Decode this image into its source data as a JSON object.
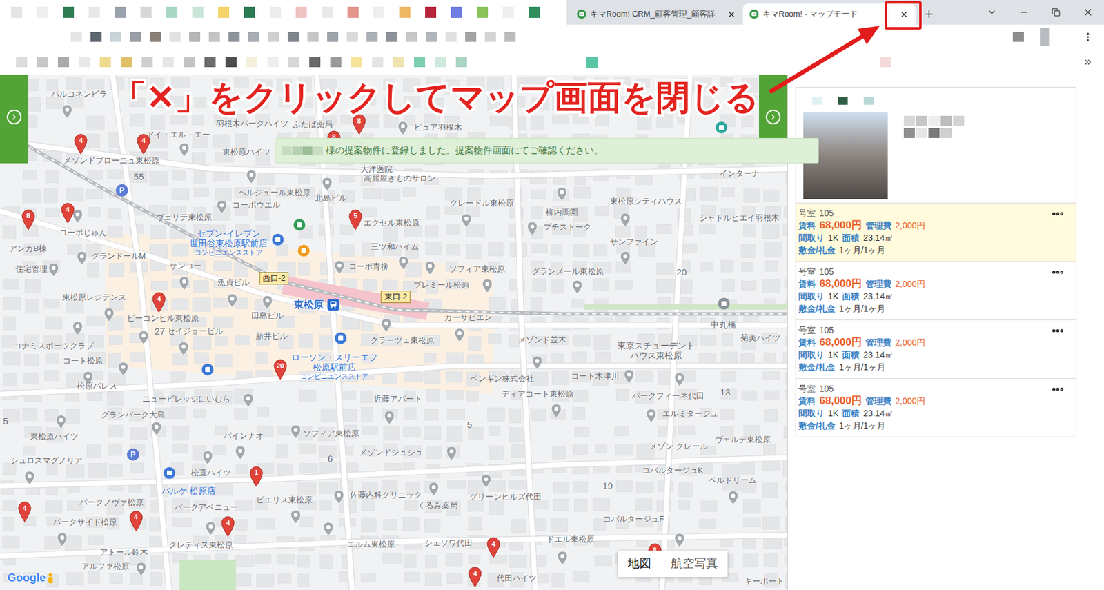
{
  "browser": {
    "tabs": [
      {
        "label": "キマRoom! CRM_顧客管理_顧客詳",
        "selected": false
      },
      {
        "label": "キマRoom! - マップモード",
        "selected": true
      }
    ]
  },
  "annotation": {
    "text": "「✕」をクリックしてマップ画面を閉じる"
  },
  "notice": {
    "text": "様の提案物件に登録しました。提案物件画面にてご確認ください。"
  },
  "map": {
    "places": [
      {
        "label": "バルコネンビラ"
      },
      {
        "label": "羽根木パークハイツ"
      },
      {
        "label": "ふたば薬局"
      },
      {
        "label": "ピュア羽根木"
      },
      {
        "label": "アイ・エル・エー"
      },
      {
        "label": "メゾンドブローニュ東松原"
      },
      {
        "label": "東松原ハイツ"
      },
      {
        "label": "大洋医院"
      },
      {
        "label": "高麗屋きものサロン"
      },
      {
        "label": "インターナ"
      },
      {
        "label": "ベルジュール東松原"
      },
      {
        "label": "北島ビル"
      },
      {
        "label": "クレードル東松原"
      },
      {
        "label": "柳内調園"
      },
      {
        "label": "東松原シティハウス"
      },
      {
        "label": "シャトルヒエイ羽根木"
      },
      {
        "label": "コーポウエル"
      },
      {
        "label": "ヴェリテ東松原"
      },
      {
        "label": "エクセル東松原"
      },
      {
        "label": "プチストーク"
      },
      {
        "label": "サンファイン"
      },
      {
        "label": "コーポじゅん"
      },
      {
        "label": "グランドールM"
      },
      {
        "label": "アンカB棟"
      },
      {
        "label": "三ツ和ハイム"
      },
      {
        "label": "コーポ青柳"
      },
      {
        "label": "ソフィア東松原"
      },
      {
        "label": "グランメール東松原"
      },
      {
        "label": "住宅管理"
      },
      {
        "label": "サンコー"
      },
      {
        "label": "魚貞ビル"
      },
      {
        "label": "プレミール松原"
      },
      {
        "label": "東松原レジデンス"
      },
      {
        "label": "カーサビエン"
      },
      {
        "label": "ビーコンヒル東松原"
      },
      {
        "label": "セイジョービル"
      },
      {
        "label": "田島ビル"
      },
      {
        "label": "新井ビル"
      },
      {
        "label": "クラーツェ東松原"
      },
      {
        "label": "メゾンド並木"
      },
      {
        "label": "コナミスポーツクラブ"
      },
      {
        "label": "コート松原"
      },
      {
        "label": "ペンギン株式会社"
      },
      {
        "label": "コート木津川"
      },
      {
        "label": "松原パレス"
      },
      {
        "label": "ディアコート東松原"
      },
      {
        "label": "パークフィーネ代田"
      },
      {
        "label": "近藤アパート"
      },
      {
        "label": "ニュービレッジにいむら"
      },
      {
        "label": "グランパーク大島"
      },
      {
        "label": "エルミタージュ"
      },
      {
        "label": "東松原ハイツ"
      },
      {
        "label": "ソフィア東松原"
      },
      {
        "label": "メゾンドシュシュ"
      },
      {
        "label": "パインナオ"
      },
      {
        "label": "メゾン クレール"
      },
      {
        "label": "ヴェルデ東松原"
      },
      {
        "label": "シュロスマグノリア"
      },
      {
        "label": "松直ハイツ"
      },
      {
        "label": "コバルタージュK"
      },
      {
        "label": "ベルドリーム"
      },
      {
        "label": "佐藤内科クリニック"
      },
      {
        "label": "グリーンヒルズ代田"
      },
      {
        "label": "ピエリス東松原"
      },
      {
        "label": "パークノヴァ松原"
      },
      {
        "label": "パークアベニュー"
      },
      {
        "label": "くるみ薬局"
      },
      {
        "label": "コバルタージュF"
      },
      {
        "label": "パークサイド松原"
      },
      {
        "label": "クレティス東松原"
      },
      {
        "label": "シェソワ代田"
      },
      {
        "label": "エルム東松原"
      },
      {
        "label": "ドエル東松原"
      },
      {
        "label": "アトール鈴木"
      },
      {
        "label": "アルファ松原"
      },
      {
        "label": "代田ハイツ"
      },
      {
        "label": "キーポート"
      },
      {
        "label": "菊美ハイツ"
      }
    ],
    "pois": [
      {
        "lines": [
          "セブン-イレブン",
          "世田谷東松原駅前店",
          "コンビニエンスストア"
        ],
        "color": "#2a6bd1"
      },
      {
        "lines": [
          "ローソン・スリーエフ",
          "松原駅前店",
          "コンビニエンスストア"
        ],
        "color": "#2a6bd1"
      },
      {
        "lines": [
          "パルケ 松原店"
        ],
        "color": "#2a6bd1"
      },
      {
        "lines": [
          "中丸橋"
        ],
        "color": "#5f6368"
      },
      {
        "lines": [
          "東京スチューデント",
          "ハウス東松原"
        ],
        "color": "#5f6368"
      }
    ],
    "station": {
      "label": "東松原"
    },
    "exits": [
      {
        "label": "西口-2"
      },
      {
        "label": "東口-2"
      }
    ],
    "blocks": [
      {
        "label": "55"
      },
      {
        "label": "20"
      },
      {
        "label": "27"
      },
      {
        "label": "13"
      },
      {
        "label": "5"
      },
      {
        "label": "6"
      },
      {
        "label": "19"
      },
      {
        "label": "5"
      }
    ],
    "markers": [
      {
        "count": "4"
      },
      {
        "count": "4"
      },
      {
        "count": "8"
      },
      {
        "count": "4"
      },
      {
        "count": "5"
      },
      {
        "count": "8"
      },
      {
        "count": "8"
      },
      {
        "count": "4"
      },
      {
        "count": "20"
      },
      {
        "count": "1"
      },
      {
        "count": "4"
      },
      {
        "count": "4"
      },
      {
        "count": "4"
      },
      {
        "count": "4"
      },
      {
        "count": "4"
      },
      {
        "count": "8"
      }
    ],
    "parking": [
      {
        "glyph": "P"
      },
      {
        "glyph": "P"
      }
    ],
    "map_types": [
      {
        "label": "地図",
        "selected": true
      },
      {
        "label": "航空写真",
        "selected": false
      }
    ],
    "attribution": "Google"
  },
  "property": {
    "units": [
      {
        "room_label": "号室",
        "room": "105",
        "rent_label": "賃料",
        "rent": "68,000円",
        "fee_label": "管理費",
        "fee": "2,000円",
        "layout_label": "間取り",
        "layout": "1K",
        "area_label": "面積",
        "area": "23.14㎡",
        "deposit_label": "敷金/礼金",
        "deposit": "1ヶ月/1ヶ月",
        "selected": true
      },
      {
        "room_label": "号室",
        "room": "105",
        "rent_label": "賃料",
        "rent": "68,000円",
        "fee_label": "管理費",
        "fee": "2,000円",
        "layout_label": "間取り",
        "layout": "1K",
        "area_label": "面積",
        "area": "23.14㎡",
        "deposit_label": "敷金/礼金",
        "deposit": "1ヶ月/1ヶ月",
        "selected": false
      },
      {
        "room_label": "号室",
        "room": "105",
        "rent_label": "賃料",
        "rent": "68,000円",
        "fee_label": "管理費",
        "fee": "2,000円",
        "layout_label": "間取り",
        "layout": "1K",
        "area_label": "面積",
        "area": "23.14㎡",
        "deposit_label": "敷金/礼金",
        "deposit": "1ヶ月/1ヶ月",
        "selected": false
      },
      {
        "room_label": "号室",
        "room": "105",
        "rent_label": "賃料",
        "rent": "68,000円",
        "fee_label": "管理費",
        "fee": "2,000円",
        "layout_label": "間取り",
        "layout": "1K",
        "area_label": "面積",
        "area": "23.14㎡",
        "deposit_label": "敷金/礼金",
        "deposit": "1ヶ月/1ヶ月",
        "selected": false
      }
    ]
  }
}
